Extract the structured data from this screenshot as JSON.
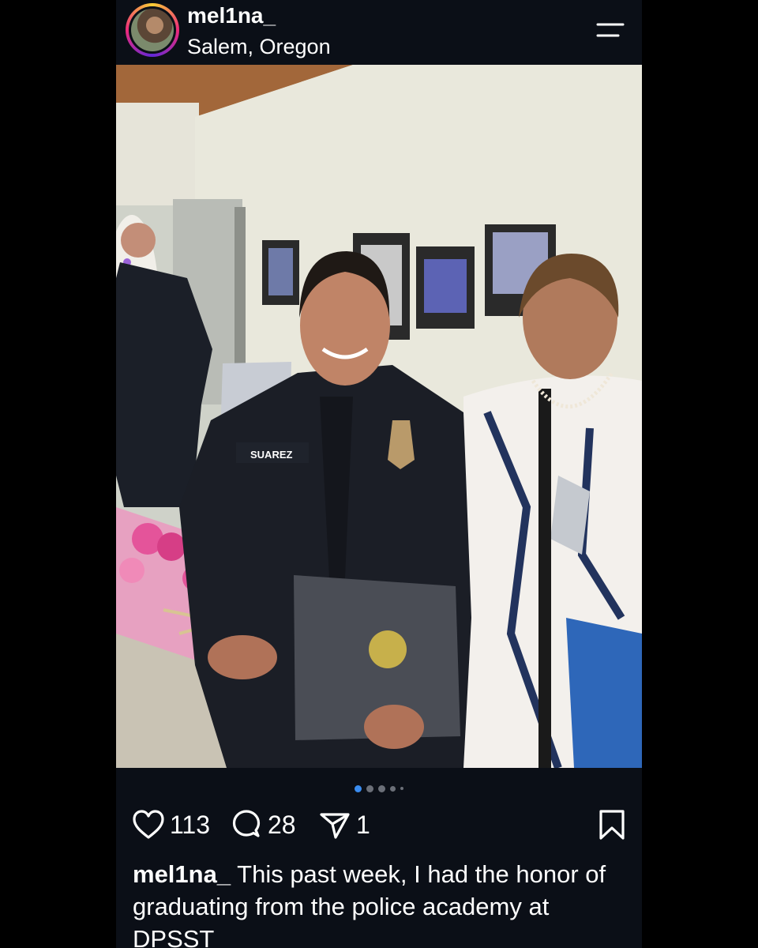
{
  "post": {
    "username": "mel1na_",
    "location": "Salem, Oregon",
    "likes": "113",
    "comments": "28",
    "shares": "1",
    "caption_user": "mel1na_",
    "caption_text": "This past week, I had the honor of graduating from the police academy at DPSST",
    "carousel": {
      "pages": 5,
      "active": 1
    }
  },
  "photo_text": {
    "name_tag": "SUAREZ"
  },
  "icons": {
    "menu": "menu-icon",
    "like": "heart-icon",
    "comment": "comment-icon",
    "share": "send-icon",
    "save": "bookmark-icon"
  },
  "colors": {
    "background": "#000000",
    "panel": "#0b0f17",
    "active_dot": "#3a8cf0",
    "text": "#ffffff"
  }
}
